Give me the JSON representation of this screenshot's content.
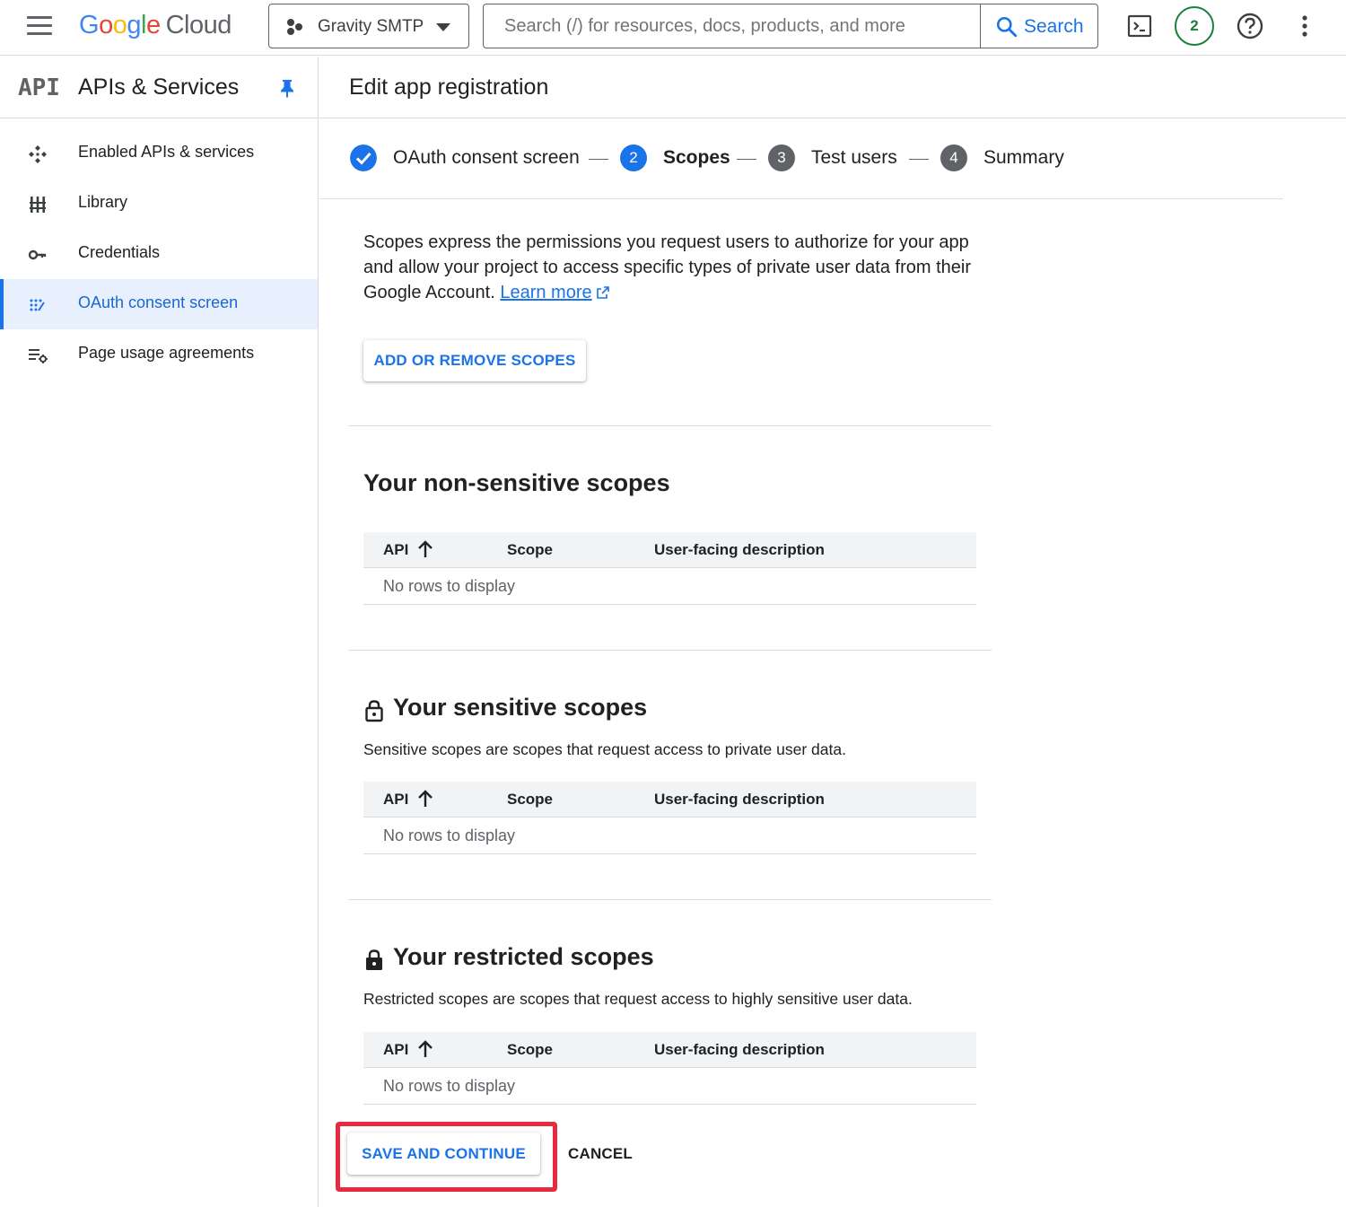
{
  "topbar": {
    "logo_google": [
      "G",
      "o",
      "o",
      "g",
      "l",
      "e"
    ],
    "logo_cloud": "Cloud",
    "project_name": "Gravity SMTP",
    "search_placeholder": "Search (/) for resources, docs, products, and more",
    "search_button": "Search",
    "notification_count": "2"
  },
  "sidebar": {
    "badge": "API",
    "title": "APIs & Services",
    "items": [
      {
        "label": "Enabled APIs & services",
        "icon": "enabled-apis-icon",
        "active": false
      },
      {
        "label": "Library",
        "icon": "library-icon",
        "active": false
      },
      {
        "label": "Credentials",
        "icon": "key-icon",
        "active": false
      },
      {
        "label": "OAuth consent screen",
        "icon": "oauth-icon",
        "active": true
      },
      {
        "label": "Page usage agreements",
        "icon": "agreements-icon",
        "active": false
      }
    ]
  },
  "main": {
    "title": "Edit app registration",
    "steps": [
      {
        "label": "OAuth consent screen",
        "marker": "",
        "state": "done"
      },
      {
        "label": "Scopes",
        "marker": "2",
        "state": "current"
      },
      {
        "label": "Test users",
        "marker": "3",
        "state": "upcoming"
      },
      {
        "label": "Summary",
        "marker": "4",
        "state": "upcoming"
      }
    ],
    "intro_text": "Scopes express the permissions you request users to authorize for your app and allow your project to access specific types of private user data from their Google Account.",
    "learn_more": "Learn more",
    "add_scopes_button": "ADD OR REMOVE SCOPES",
    "sections": [
      {
        "title": "Your non-sensitive scopes",
        "description": ""
      },
      {
        "title": "Your sensitive scopes",
        "description": "Sensitive scopes are scopes that request access to private user data."
      },
      {
        "title": "Your restricted scopes",
        "description": "Restricted scopes are scopes that request access to highly sensitive user data."
      }
    ],
    "table_columns": [
      "API",
      "Scope",
      "User-facing description"
    ],
    "empty_message": "No rows to display",
    "save_button": "SAVE AND CONTINUE",
    "cancel_button": "CANCEL"
  },
  "colors": {
    "accent": "#1a73e8",
    "active_bg": "#e8f0fe",
    "highlight": "#e8293f",
    "notification": "#188038"
  }
}
